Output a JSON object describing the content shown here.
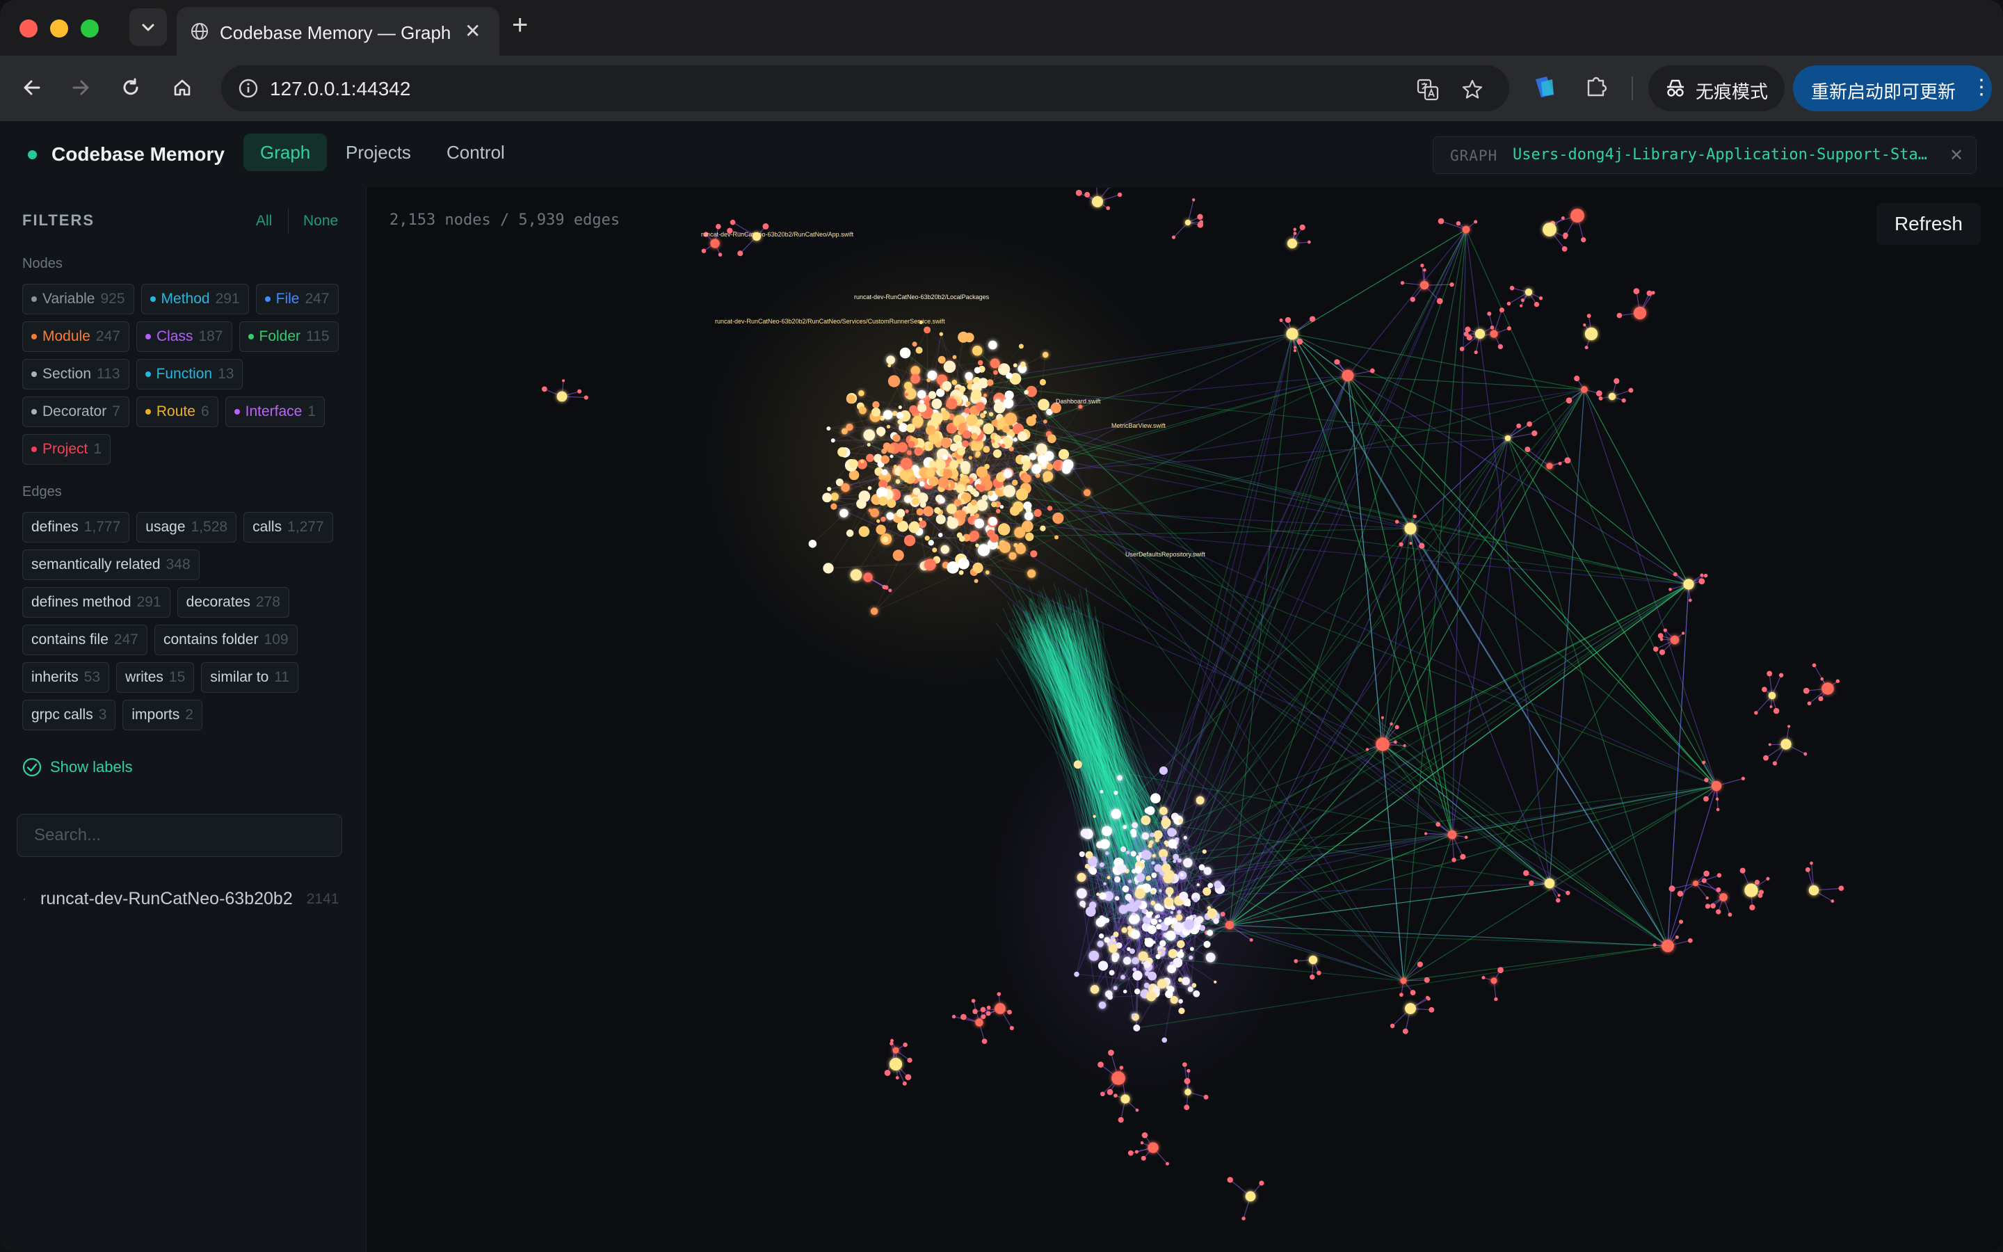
{
  "browser": {
    "tab_title": "Codebase Memory — Graph",
    "url": "127.0.0.1:44342",
    "incognito_label": "无痕模式",
    "update_label": "重新启动即可更新"
  },
  "header": {
    "brand": "Codebase Memory",
    "tabs": [
      {
        "label": "Graph",
        "active": true
      },
      {
        "label": "Projects",
        "active": false
      },
      {
        "label": "Control",
        "active": false
      }
    ],
    "graph_key": "GRAPH",
    "graph_value": "Users-dong4j-Library-Application-Support-Sta…"
  },
  "filters": {
    "title": "FILTERS",
    "all": "All",
    "none": "None",
    "nodes_label": "Nodes",
    "edges_label": "Edges",
    "nodes": [
      {
        "label": "Variable",
        "count": "925",
        "color": "#8b95a0"
      },
      {
        "label": "Method",
        "count": "291",
        "color": "#22b8e0"
      },
      {
        "label": "File",
        "count": "247",
        "color": "#3f8cff"
      },
      {
        "label": "Module",
        "count": "247",
        "color": "#ff7a2e"
      },
      {
        "label": "Class",
        "count": "187",
        "color": "#b65cff"
      },
      {
        "label": "Folder",
        "count": "115",
        "color": "#2fcf6b"
      },
      {
        "label": "Section",
        "count": "113",
        "color": "#aab4bd"
      },
      {
        "label": "Function",
        "count": "13",
        "color": "#22b8e0"
      },
      {
        "label": "Decorator",
        "count": "7",
        "color": "#aab4bd"
      },
      {
        "label": "Route",
        "count": "6",
        "color": "#f0b020"
      },
      {
        "label": "Interface",
        "count": "1",
        "color": "#c060ff"
      },
      {
        "label": "Project",
        "count": "1",
        "color": "#ff3b57"
      }
    ],
    "edges": [
      {
        "label": "defines",
        "count": "1,777"
      },
      {
        "label": "usage",
        "count": "1,528"
      },
      {
        "label": "calls",
        "count": "1,277"
      },
      {
        "label": "semantically related",
        "count": "348"
      },
      {
        "label": "defines method",
        "count": "291"
      },
      {
        "label": "decorates",
        "count": "278"
      },
      {
        "label": "contains file",
        "count": "247"
      },
      {
        "label": "contains folder",
        "count": "109"
      },
      {
        "label": "inherits",
        "count": "53"
      },
      {
        "label": "writes",
        "count": "15"
      },
      {
        "label": "similar to",
        "count": "11"
      },
      {
        "label": "grpc calls",
        "count": "3"
      },
      {
        "label": "imports",
        "count": "2"
      }
    ],
    "show_labels": "Show labels",
    "search_placeholder": "Search...",
    "project": {
      "name": "runcat-dev-RunCatNeo-63b20b2",
      "count": "2141"
    }
  },
  "graph": {
    "stats": "2,153 nodes / 5,939 edges",
    "refresh": "Refresh",
    "labels": [
      "runcat-dev-RunCatNeo-63b20b2/RunCatNeo/App.swift",
      "runcat-dev-RunCatNeo-63b20b2/LocalPackages",
      "runcat-dev-RunCatNeo-63b20b2/RunCatNeo/Services/CustomRunnerService.swift",
      "Dashboard.swift",
      "MetricBarView.swift",
      "UserDefaultsRepository.swift"
    ]
  }
}
